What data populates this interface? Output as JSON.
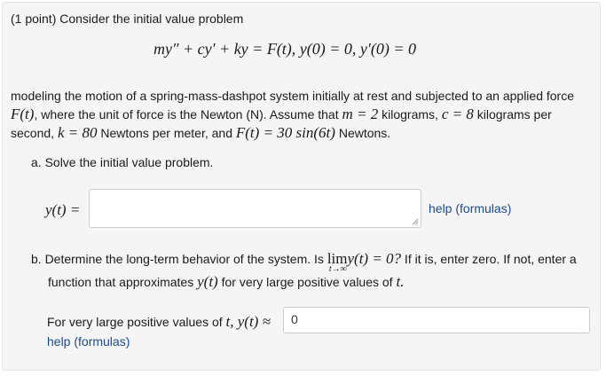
{
  "header": "(1 point) Consider the initial value problem",
  "equation": "my″ + cy′ + ky = F(t),   y(0) = 0,   y′(0) = 0",
  "paragraph": {
    "line1": "modeling the motion of a spring-mass-dashpot system initially at rest and subjected to an applied force",
    "line2_a": "F(t)",
    "line2_b": ", where the unit of force is the Newton (N). Assume that ",
    "line2_m": "m = 2",
    "line2_c_text": " kilograms, ",
    "line2_c": "c = 8",
    "line2_d": " kilograms per",
    "line3_a": "second, ",
    "line3_k": "k = 80",
    "line3_b": " Newtons per meter, and ",
    "line3_F": "F(t) = 30 sin(6t)",
    "line3_c": " Newtons."
  },
  "part_a": {
    "label": "a.  Solve the initial value problem.",
    "y_label": "y(t) =",
    "answer_value": "",
    "help_link": "help (formulas)"
  },
  "part_b": {
    "line1_a": "b.  Determine the long-term behavior of the system. Is ",
    "lim": "lim",
    "lim_sub": "t→∞",
    "lim_expr": "y(t) = 0?",
    "line1_b": " If it is, enter zero. If not, enter a",
    "line2_a": "function that approximates ",
    "line2_y": "y(t)",
    "line2_b": " for very large positive values of ",
    "line2_t": "t.",
    "fvl_text": "For very large positive values of ",
    "fvl_t": "t, y(t) ≈",
    "answer_value": "0",
    "help_link": "help (formulas)"
  }
}
